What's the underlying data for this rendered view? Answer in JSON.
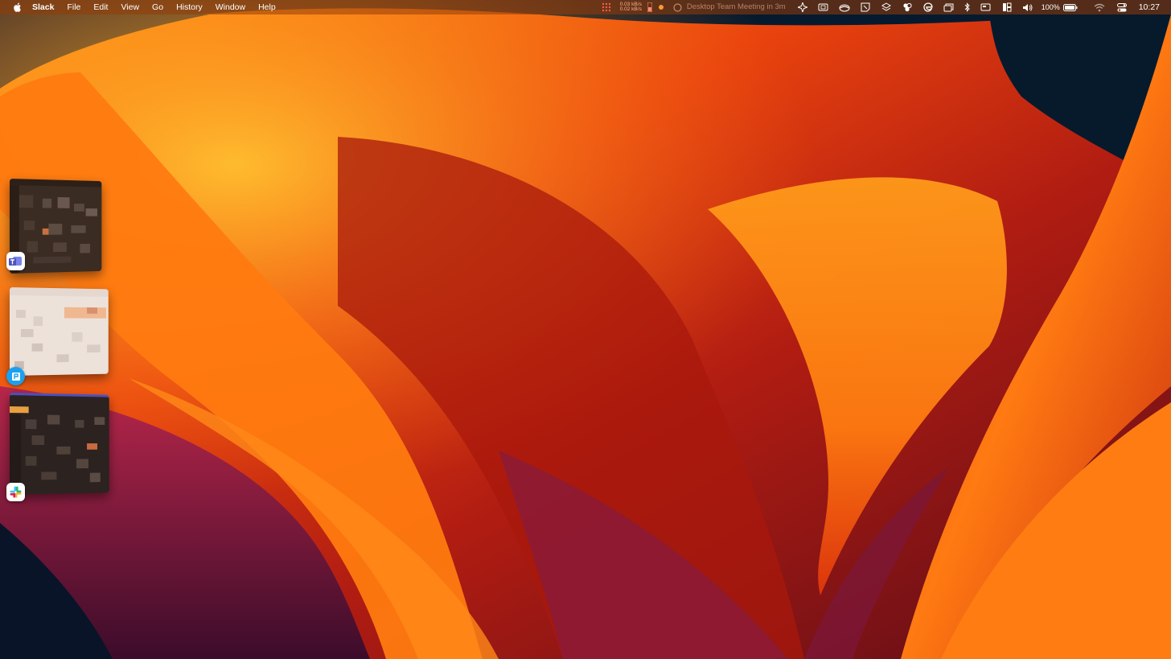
{
  "menubar": {
    "app_name": "Slack",
    "menus": [
      "File",
      "Edit",
      "View",
      "Go",
      "History",
      "Window",
      "Help"
    ],
    "net_up": "0.03 kB/s",
    "net_down": "0.02 kB/s",
    "meeting": "Desktop Team Meeting in 3m",
    "battery": "100%",
    "clock": "10:27"
  },
  "stage_manager": {
    "windows": [
      {
        "app": "Microsoft Teams",
        "icon": "teams-icon",
        "theme": "dark"
      },
      {
        "app": "Preview",
        "icon": "preview-icon",
        "theme": "light"
      },
      {
        "app": "Slack",
        "icon": "slack-icon",
        "theme": "dark"
      }
    ]
  },
  "colors": {
    "menubar_bg": "#963c0a",
    "wallpaper_orange": "#ff8a10",
    "wallpaper_red": "#c8200c",
    "wallpaper_dark": "#051a2e"
  }
}
